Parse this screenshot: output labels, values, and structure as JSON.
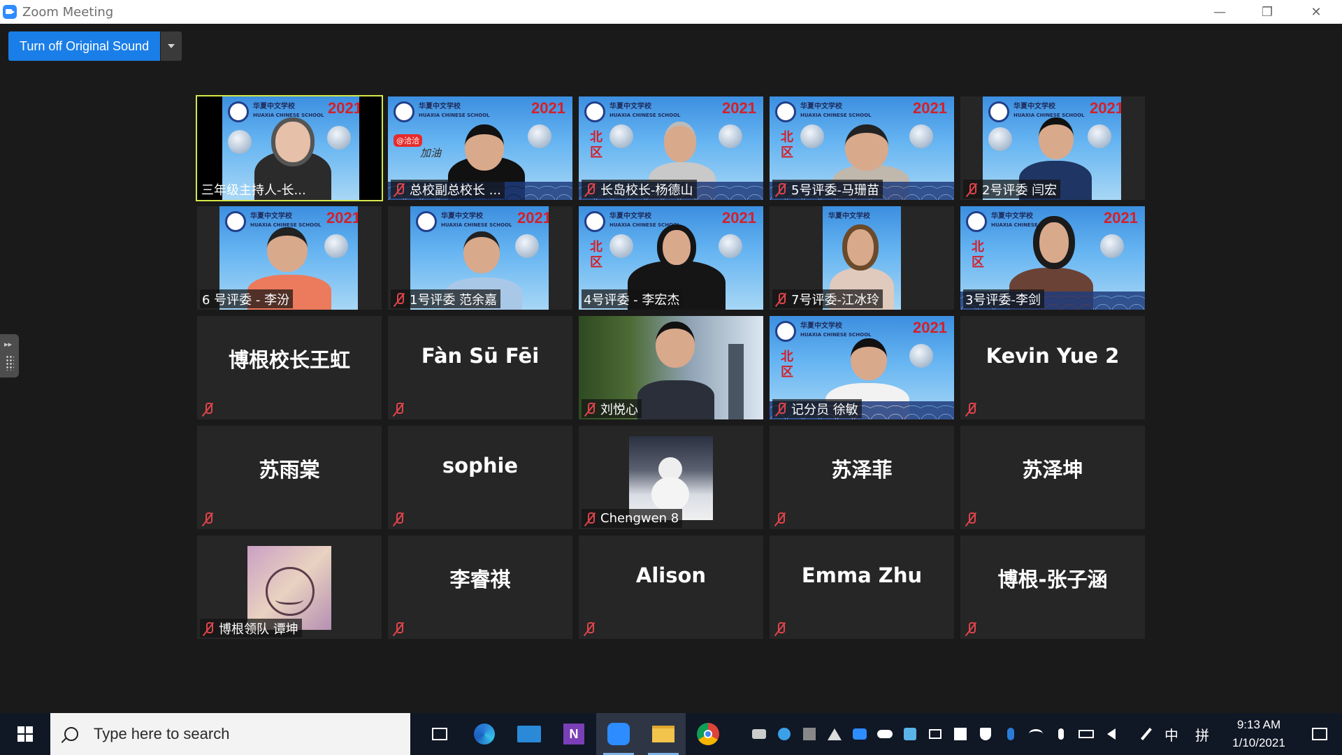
{
  "window": {
    "title": "Zoom Meeting",
    "minimize": "—",
    "restore": "❐",
    "close": "✕"
  },
  "toolbar": {
    "original_sound_label": "Turn off Original Sound"
  },
  "tiles": [
    {
      "label": "三年级主持人-长...",
      "type": "video",
      "muted": false,
      "active": true
    },
    {
      "label": "总校副总校长 ...",
      "type": "video",
      "muted": true
    },
    {
      "label": "长岛校长-杨德山",
      "type": "video",
      "muted": true
    },
    {
      "label": "5号评委-马珊苗",
      "type": "video",
      "muted": true
    },
    {
      "label": "2号评委 闫宏",
      "type": "video",
      "muted": true
    },
    {
      "label": "6 号评委 - 李汾",
      "type": "video",
      "muted": false
    },
    {
      "label": "1号评委 范余嘉",
      "type": "video",
      "muted": true
    },
    {
      "label": "4号评委 -  李宏杰",
      "type": "video",
      "muted": false
    },
    {
      "label": "7号评委-江冰玲",
      "type": "video",
      "muted": true
    },
    {
      "label": "3号评委-李剑",
      "type": "video",
      "muted": false
    },
    {
      "name": "博根校长王虹",
      "type": "name",
      "muted": true
    },
    {
      "name": "Fàn Sū Fēi",
      "type": "name",
      "muted": true
    },
    {
      "label": "刘悦心",
      "type": "video",
      "muted": true
    },
    {
      "label": "记分员 徐敏",
      "type": "video",
      "muted": true
    },
    {
      "name": "Kevin Yue 2",
      "type": "name",
      "muted": true
    },
    {
      "name": "苏雨棠",
      "type": "name",
      "muted": true
    },
    {
      "name": "sophie",
      "type": "name",
      "muted": true
    },
    {
      "label": "Chengwen 8",
      "type": "photo",
      "muted": true
    },
    {
      "name": "苏泽菲",
      "type": "name",
      "muted": true
    },
    {
      "name": "苏泽坤",
      "type": "name",
      "muted": true
    },
    {
      "label": "博根领队 谭坤",
      "type": "photo",
      "muted": true
    },
    {
      "name": "李睿祺",
      "type": "name",
      "muted": true
    },
    {
      "name": "Alison",
      "type": "name",
      "muted": true
    },
    {
      "name": "Emma Zhu",
      "type": "name",
      "muted": true
    },
    {
      "name": "博根-张子涵",
      "type": "name",
      "muted": true
    }
  ],
  "background": {
    "year": "2021",
    "region": "北区",
    "school_cn": "华夏中文学校",
    "school_en": "HUAXIA CHINESE SCHOOL"
  },
  "overlay_text": {
    "badge": "@洽洽",
    "cheer": "加油"
  },
  "taskbar": {
    "search_placeholder": "Type here to search",
    "time": "9:13 AM",
    "date": "1/10/2021",
    "ime_lang": "中",
    "ime_mode": "拼"
  }
}
